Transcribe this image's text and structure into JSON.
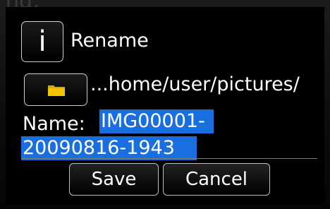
{
  "dialog": {
    "title": "Rename",
    "path": "...home/user/pictures/",
    "name_label": "Name:",
    "name_value_line1": "IMG00001-",
    "name_value_line2": "20090816-1943"
  },
  "buttons": {
    "save": "Save",
    "cancel": "Cancel"
  },
  "icons": {
    "info": "info-icon",
    "folder": "folder-icon",
    "info_glyph": "i"
  },
  "colors": {
    "selection": "#1a6fe0",
    "folder": "#f5c400",
    "dialog_bg": "#000000"
  }
}
